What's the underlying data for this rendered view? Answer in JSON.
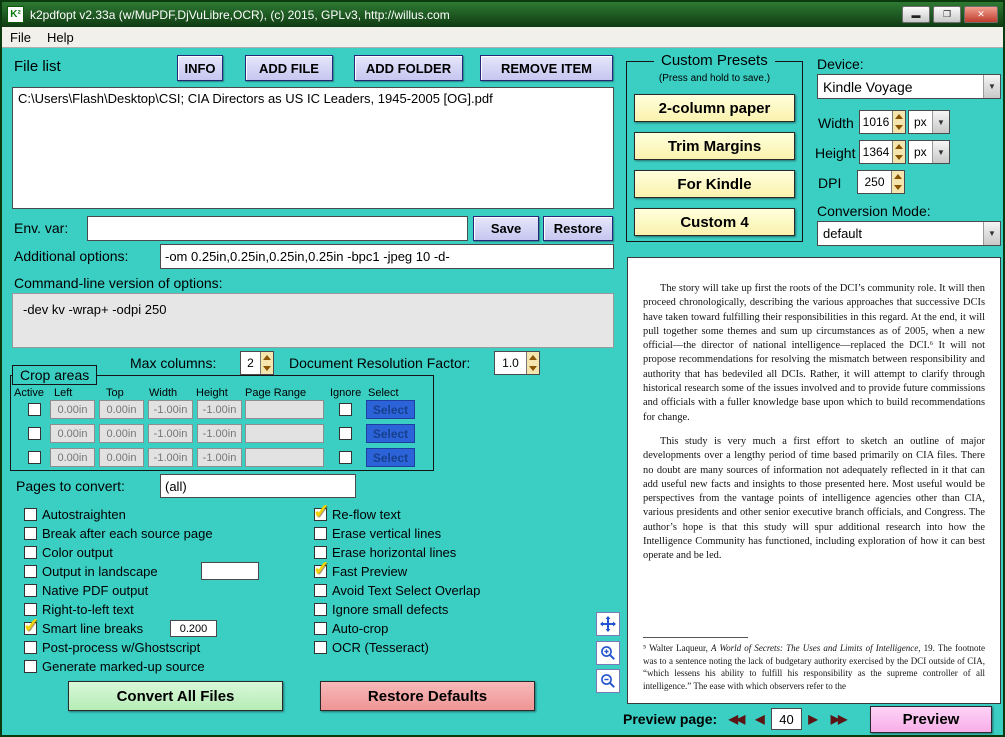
{
  "window": {
    "title": "k2pdfopt v2.33a (w/MuPDF,DjVuLibre,OCR), (c) 2015, GPLv3, http://willus.com",
    "icon_text": "K²",
    "menu": {
      "file": "File",
      "help": "Help"
    }
  },
  "file_section": {
    "label": "File list",
    "info_button": "INFO",
    "add_file_button": "ADD FILE",
    "add_folder_button": "ADD FOLDER",
    "remove_item_button": "REMOVE ITEM",
    "files": [
      "C:\\Users\\Flash\\Desktop\\CSI; CIA Directors as US IC Leaders, 1945-2005 [OG].pdf"
    ]
  },
  "env_var": {
    "label": "Env. var:",
    "value": "",
    "save_button": "Save",
    "restore_button": "Restore"
  },
  "additional_options": {
    "label": "Additional options:",
    "value": "-om 0.25in,0.25in,0.25in,0.25in -bpc1 -jpeg 10 -d-"
  },
  "cmdline": {
    "label": "Command-line version of options:",
    "value": "-dev kv -wrap+ -odpi 250"
  },
  "columns": {
    "max_label": "Max columns:",
    "max_value": "2",
    "res_label": "Document Resolution Factor:",
    "res_value": "1.0"
  },
  "crop_areas": {
    "title": "Crop areas",
    "headers": {
      "active": "Active",
      "left": "Left",
      "top": "Top",
      "width": "Width",
      "height": "Height",
      "page_range": "Page Range",
      "ignore": "Ignore",
      "select": "Select"
    },
    "rows": [
      {
        "active": false,
        "left": "0.00in",
        "top": "0.00in",
        "width": "-1.00in",
        "height": "-1.00in",
        "page_range": "",
        "ignore": false,
        "select_button": "Select"
      },
      {
        "active": false,
        "left": "0.00in",
        "top": "0.00in",
        "width": "-1.00in",
        "height": "-1.00in",
        "page_range": "",
        "ignore": false,
        "select_button": "Select"
      },
      {
        "active": false,
        "left": "0.00in",
        "top": "0.00in",
        "width": "-1.00in",
        "height": "-1.00in",
        "page_range": "",
        "ignore": false,
        "select_button": "Select"
      }
    ]
  },
  "pages": {
    "label": "Pages to convert:",
    "value": "(all)"
  },
  "options": {
    "left": [
      {
        "label": "Autostraighten",
        "checked": false
      },
      {
        "label": "Break after each source page",
        "checked": false
      },
      {
        "label": "Color output",
        "checked": false
      },
      {
        "label": "Output in landscape",
        "checked": false,
        "extra": ""
      },
      {
        "label": "Native PDF output",
        "checked": false
      },
      {
        "label": "Right-to-left text",
        "checked": false
      },
      {
        "label": "Smart line breaks",
        "checked": true,
        "extra": "0.200"
      },
      {
        "label": "Post-process w/Ghostscript",
        "checked": false
      },
      {
        "label": "Generate marked-up source",
        "checked": false
      }
    ],
    "right": [
      {
        "label": "Re-flow text",
        "checked": true
      },
      {
        "label": "Erase vertical lines",
        "checked": false
      },
      {
        "label": "Erase horizontal lines",
        "checked": false
      },
      {
        "label": "Fast Preview",
        "checked": true
      },
      {
        "label": "Avoid Text Select Overlap",
        "checked": false
      },
      {
        "label": "Ignore small defects",
        "checked": false
      },
      {
        "label": "Auto-crop",
        "checked": false
      },
      {
        "label": "OCR (Tesseract)",
        "checked": false
      }
    ]
  },
  "actions": {
    "convert_button": "Convert All Files",
    "restore_defaults_button": "Restore Defaults"
  },
  "presets": {
    "title": "Custom Presets",
    "hint": "(Press and hold to save.)",
    "buttons": [
      "2-column paper",
      "Trim Margins",
      "For Kindle",
      "Custom 4"
    ]
  },
  "device": {
    "label": "Device:",
    "value": "Kindle Voyage",
    "width_label": "Width",
    "width_value": "1016",
    "width_unit": "px",
    "height_label": "Height",
    "height_value": "1364",
    "height_unit": "px",
    "dpi_label": "DPI",
    "dpi_value": "250",
    "mode_label": "Conversion Mode:",
    "mode_value": "default"
  },
  "preview": {
    "paragraphs": [
      "The story will take up first the roots of the DCI’s community role. It will then proceed chronologically, describing the various approaches that successive DCIs have taken toward fulfilling their responsibilities in this regard. At the end, it will pull together some themes and sum up circumstances as of 2005, when a new official—the director of national intelligence—replaced the DCI.⁶ It will not propose recommendations for resolving the mismatch between responsibility and authority that has bedeviled all DCIs. Rather, it will attempt to clarify through historical research some of the issues involved and to provide future commissions and officials with a fuller knowledge base upon which to build recommendations for change.",
      "This study is very much a first effort to sketch an outline of major developments over a lengthy period of time based primarily on CIA files. There no doubt are many sources of information not adequately reflected in it that can add useful new facts and insights to those presented here. Most useful would be perspectives from the vantage points of intelligence agencies other than CIA, various presidents and other senior executive branch officials, and Congress. The author’s hope is that this study will spur additional research into how the Intelligence Community has functioned, including exploration of how it can best operate and be led."
    ],
    "footnote": {
      "lead": "⁵ Walter Laqueur, ",
      "title_italic": "A World of Secrets: The Uses and Limits of Intelligence",
      "rest": ", 19. The footnote was to a sentence noting the lack of budgetary authority exercised by the DCI outside of CIA, “which lessens his ability to fulfill his responsibility as the supreme controller of all intelligence.” The ease with which observers refer to the"
    },
    "page_label": "Preview page:",
    "page_value": "40",
    "nav": {
      "first": "◀◀",
      "prev": "◀",
      "next": "▶",
      "last": "▶▶"
    },
    "preview_button": "Preview"
  },
  "colors": {
    "background": "#3BCFC4",
    "titlebar_green": "#1E5C22",
    "button_lavender": "#CCCCF0",
    "preset_yellow": "#FFFFC8",
    "convert_green": "#C8F0C8",
    "restore_pink": "#F4A0A0",
    "preview_pink": "#FBC4F2",
    "select_blue": "#2D63D8"
  }
}
